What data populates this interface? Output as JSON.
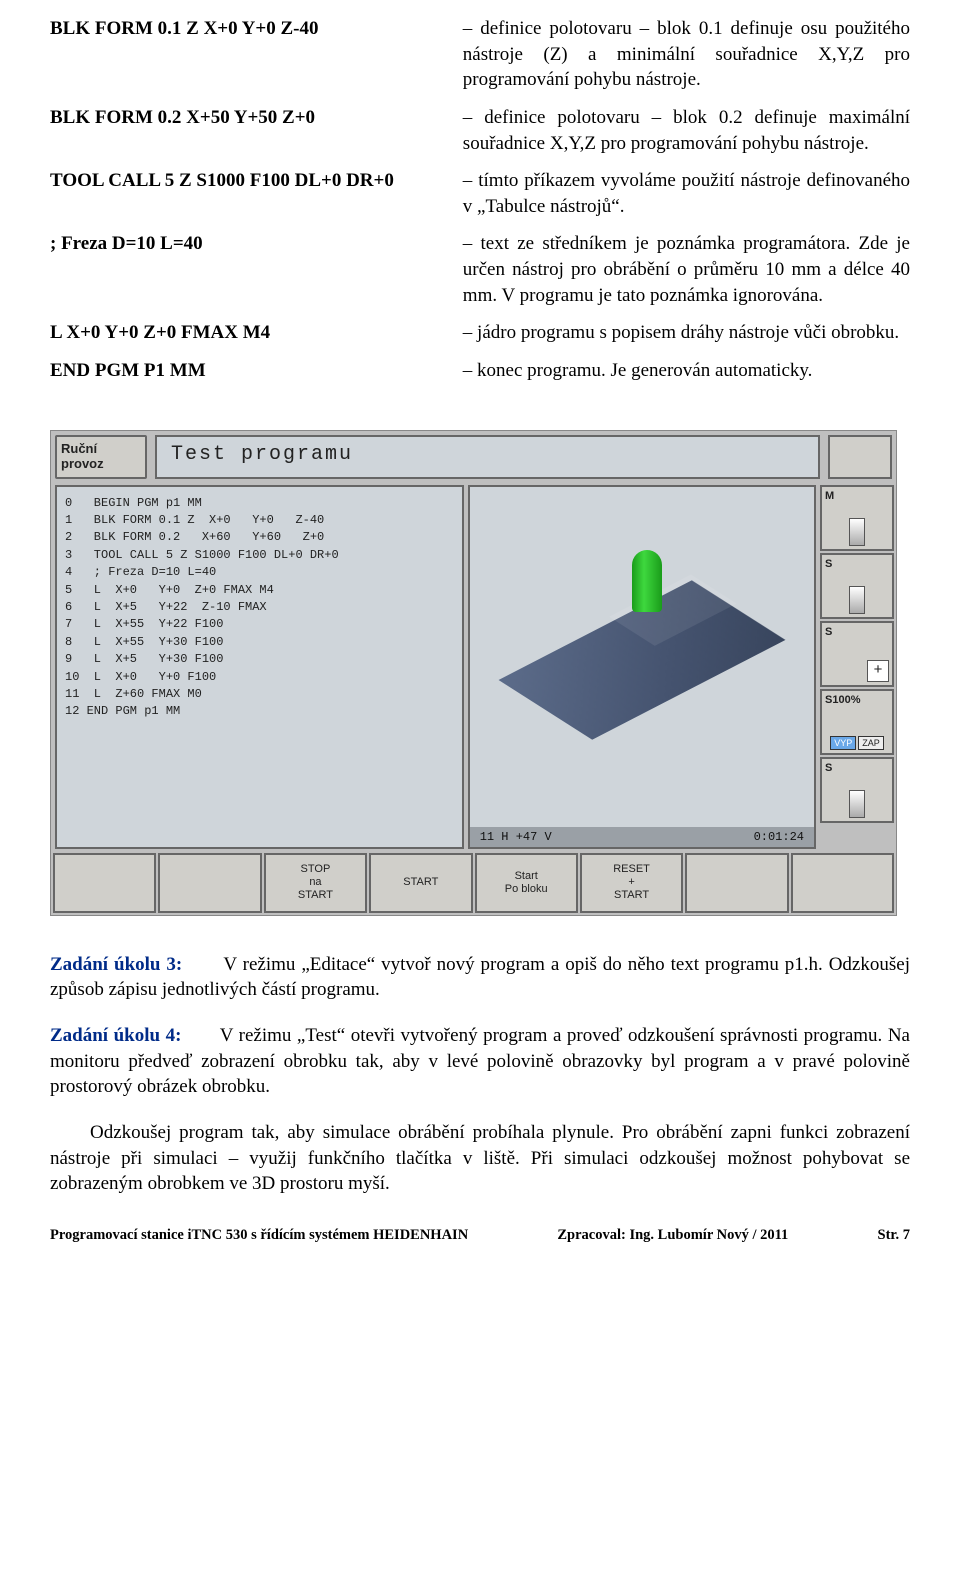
{
  "table": [
    {
      "left": "BLK FORM 0.1  Z  X+0  Y+0  Z-40",
      "right": "– definice polotovaru – blok 0.1 definuje osu použitého nástroje (Z) a minimální souřadnice X,Y,Z pro programování pohybu nástroje."
    },
    {
      "left": "BLK FORM 0.2  X+50  Y+50  Z+0",
      "right": "– definice polotovaru – blok 0.2 definuje maximální souřadnice X,Y,Z pro programování pohybu nástroje."
    },
    {
      "left": "TOOL CALL 5 Z S1000 F100 DL+0 DR+0",
      "right": "– tímto příkazem vyvoláme použití nástroje definovaného v „Tabulce nástrojů“."
    },
    {
      "left": "; Freza D=10 L=40",
      "right": "– text ze středníkem je poznámka programátora. Zde je určen nástroj pro obrábění o průměru 10 mm a délce 40 mm. V programu je tato poznámka ignorována."
    },
    {
      "left": "L  X+0  Y+0  Z+0 FMAX M4",
      "right": "– jádro programu s popisem dráhy nástroje vůči obrobku."
    },
    {
      "left": "END PGM P1 MM",
      "right": "– konec programu. Je generován automaticky."
    }
  ],
  "ui": {
    "mode1": "Ruční",
    "mode2": "provoz",
    "title": "Test programu",
    "code": "0   BEGIN PGM p1 MM\n1   BLK FORM 0.1 Z  X+0   Y+0   Z-40\n2   BLK FORM 0.2   X+60   Y+60   Z+0\n3   TOOL CALL 5 Z S1000 F100 DL+0 DR+0\n4   ; Freza D=10 L=40\n5   L  X+0   Y+0  Z+0 FMAX M4\n6   L  X+5   Y+22  Z-10 FMAX\n7   L  X+55  Y+22 F100\n8   L  X+55  Y+30 F100\n9   L  X+5   Y+30 F100\n10  L  X+0   Y+0 F100\n11  L  Z+60 FMAX M0\n12 END PGM p1 MM",
    "foot_left": "11 H +47 V",
    "foot_right": "0:01:24",
    "side": {
      "m": "M",
      "s": "S",
      "splus": "S",
      "s100": "S100%",
      "vyp": "VYP",
      "zap": "ZAP",
      "slast": "S"
    },
    "bottom": {
      "b3_1": "STOP",
      "b3_2": "na",
      "b3_3": "START",
      "b4": "START",
      "b5_1": "Start",
      "b5_2": "Po bloku",
      "b6_1": "RESET",
      "b6_2": "+",
      "b6_3": "START"
    }
  },
  "tasks": {
    "t3_lead": "Zadání úkolu 3:",
    "t3": "V režimu „Editace“ vytvoř nový program a opiš do něho text programu p1.h. Odzkoušej způsob zápisu jednotlivých částí programu.",
    "t4_lead": "Zadání úkolu 4:",
    "t4": "V režimu „Test“ otevři vytvořený program a proveď odzkoušení správnosti programu. Na monitoru předveď zobrazení obrobku tak, aby v levé polovině obrazovky byl program a v pravé polovině prostorový obrázek obrobku.",
    "p5": "Odzkoušej program tak, aby simulace obrábění probíhala plynule. Pro obrábění zapni funkci zobrazení nástroje při simulaci – využij funkčního tlačítka v liště. Při simulaci odzkoušej možnost pohybovat se zobrazeným obrobkem ve 3D prostoru myší."
  },
  "footer": {
    "left": "Programovací stanice iTNC 530  s řídícím systémem HEIDENHAIN",
    "mid": "Zpracoval: Ing.  Lubomír Nový / 2011",
    "right": "Str.   7"
  }
}
